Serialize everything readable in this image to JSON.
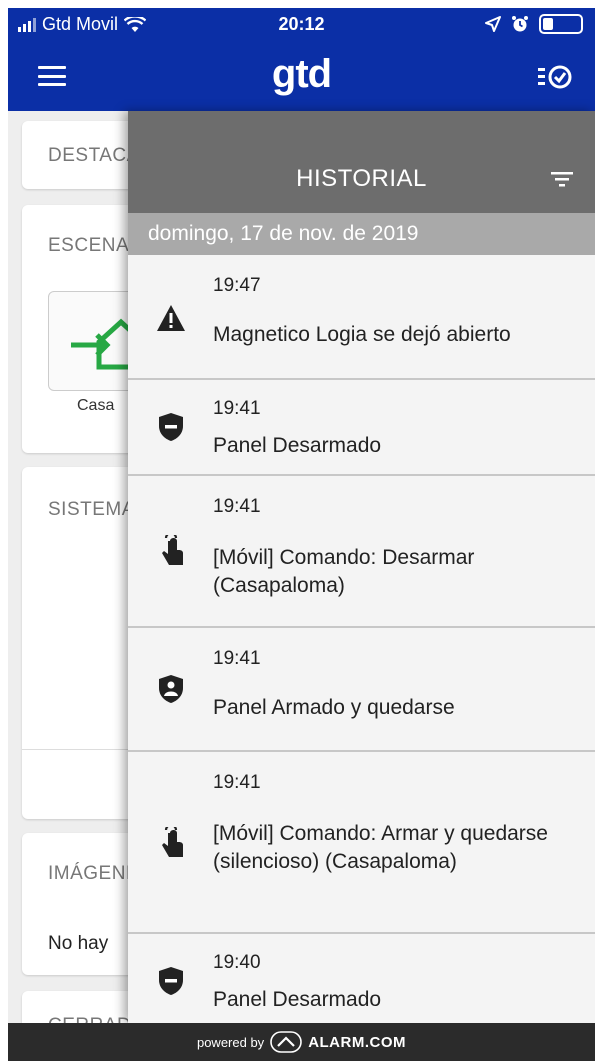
{
  "status_bar": {
    "carrier": "Gtd Movil",
    "time": "20:12"
  },
  "app": {
    "logo": "gtd"
  },
  "dashboard": {
    "card1_title": "DESTACADOS",
    "card2_title": "ESCENAS",
    "scene_label": "Casa",
    "card3_title": "SISTEMA",
    "card4_title": "IMÁGENES",
    "no_images": "No hay",
    "card5_title": "CERRADURAS"
  },
  "history": {
    "title": "HISTORIAL",
    "date": "domingo, 17 de nov. de 2019",
    "events": [
      {
        "time": "19:47",
        "text": "Magnetico Logia se dejó abierto",
        "icon": "warning-icon"
      },
      {
        "time": "19:41",
        "text": "Panel Desarmado",
        "icon": "shield-disarmed-icon"
      },
      {
        "time": "19:41",
        "text": "[Móvil] Comando: Desarmar (Casapaloma)",
        "icon": "touch-hand-icon"
      },
      {
        "time": "19:41",
        "text": "Panel Armado y quedarse",
        "icon": "shield-armed-stay-icon"
      },
      {
        "time": "19:41",
        "text": "[Móvil] Comando: Armar y quedarse  (silencioso) (Casapaloma)",
        "icon": "touch-hand-icon"
      },
      {
        "time": "19:40",
        "text": "Panel Desarmado",
        "icon": "shield-disarmed-icon"
      }
    ]
  },
  "footer": {
    "powered_by": "powered by",
    "brand": "ALARM.COM"
  },
  "colors": {
    "header_blue": "#0b2fa6",
    "panel_header_gray": "#6d6d6d",
    "date_bar_gray": "#a9a9a9",
    "scene_green": "#27a844"
  }
}
